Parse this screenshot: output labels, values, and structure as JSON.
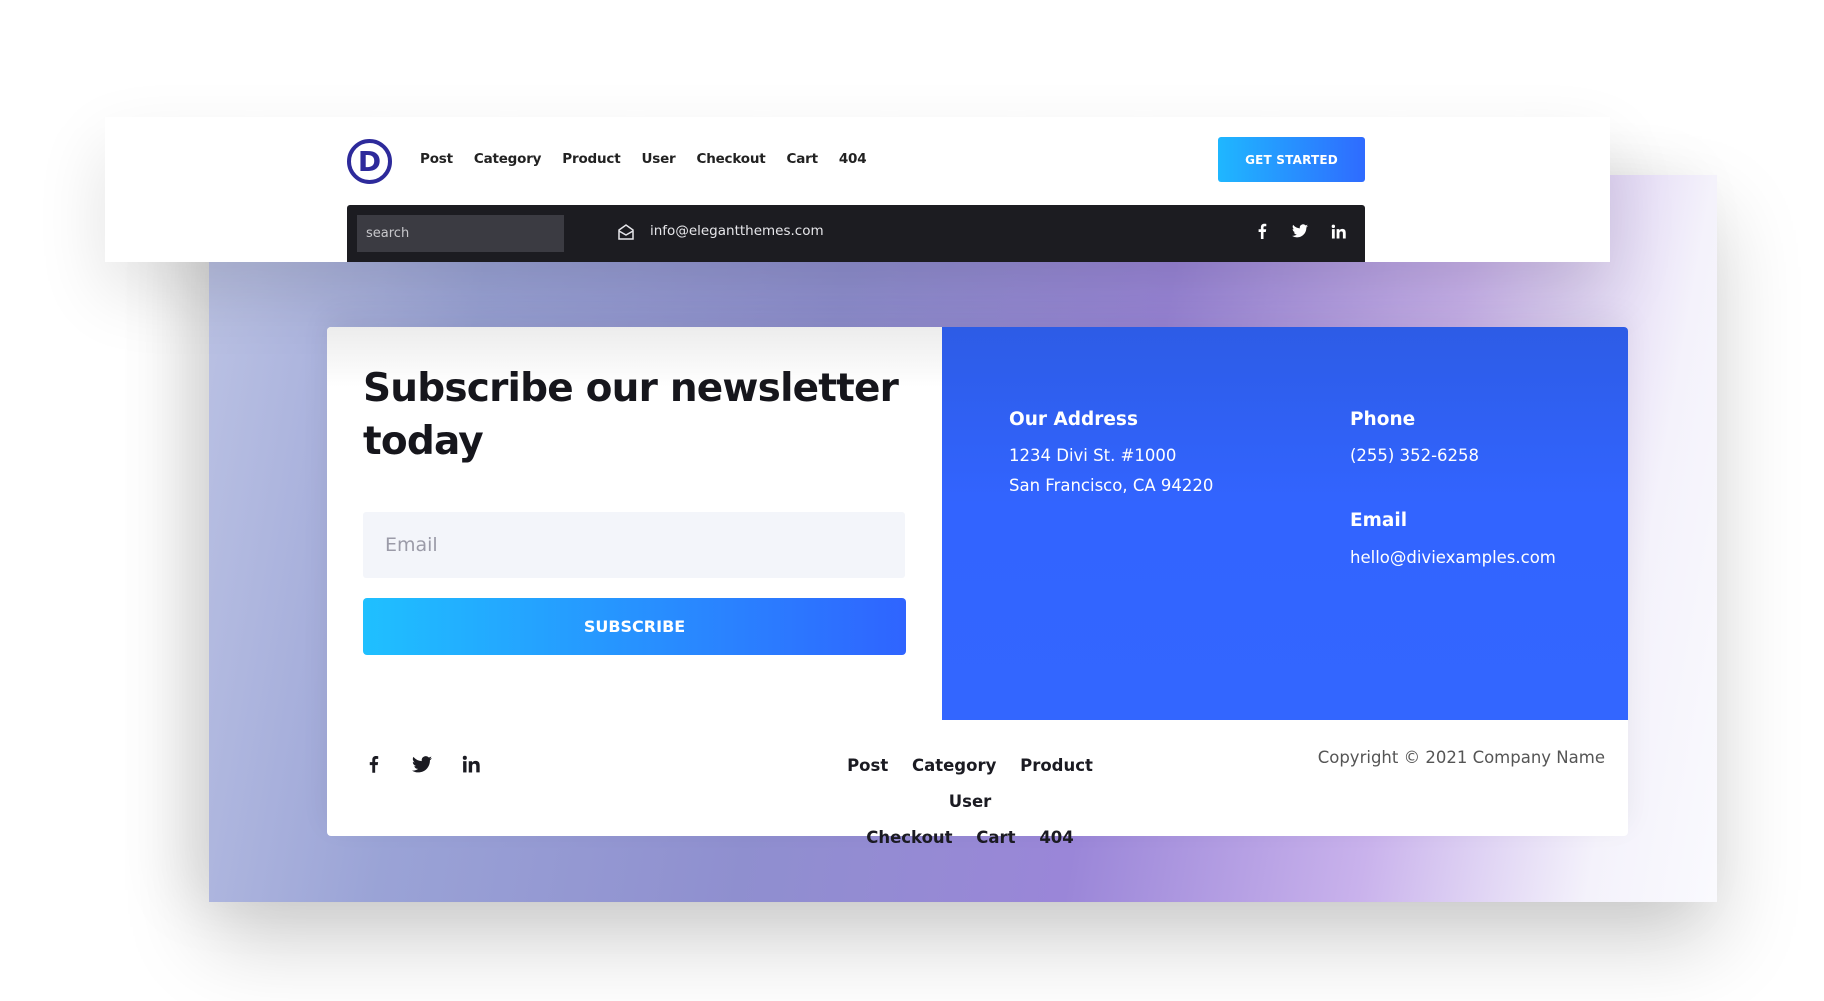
{
  "header": {
    "logo_letter": "D",
    "nav": [
      "Post",
      "Category",
      "Product",
      "User",
      "Checkout",
      "Cart",
      "404"
    ],
    "cta_label": "GET STARTED"
  },
  "topbar": {
    "search_placeholder": "search",
    "email": "info@elegantthemes.com",
    "socials": [
      "facebook-icon",
      "twitter-icon",
      "linkedin-icon"
    ]
  },
  "newsletter": {
    "title": "Subscribe our newsletter today",
    "email_placeholder": "Email",
    "subscribe_label": "SUBSCRIBE"
  },
  "contact": {
    "address_heading": "Our Address",
    "address_line1": "1234 Divi St. #1000",
    "address_line2": "San Francisco, CA 94220",
    "phone_heading": "Phone",
    "phone": "(255) 352-6258",
    "email_heading": "Email",
    "email": "hello@diviexamples.com"
  },
  "footer": {
    "socials": [
      "facebook-icon",
      "twitter-icon",
      "linkedin-icon"
    ],
    "nav": [
      "Post",
      "Category",
      "Product",
      "User",
      "Checkout",
      "Cart",
      "404"
    ],
    "copyright": "Copyright © 2021 Company Name"
  },
  "colors": {
    "brand_blue": "#3366ff",
    "logo": "#2d2a9b",
    "topbar": "#1c1c21",
    "button_start": "#1fc0ff",
    "button_end": "#2f64ff"
  }
}
